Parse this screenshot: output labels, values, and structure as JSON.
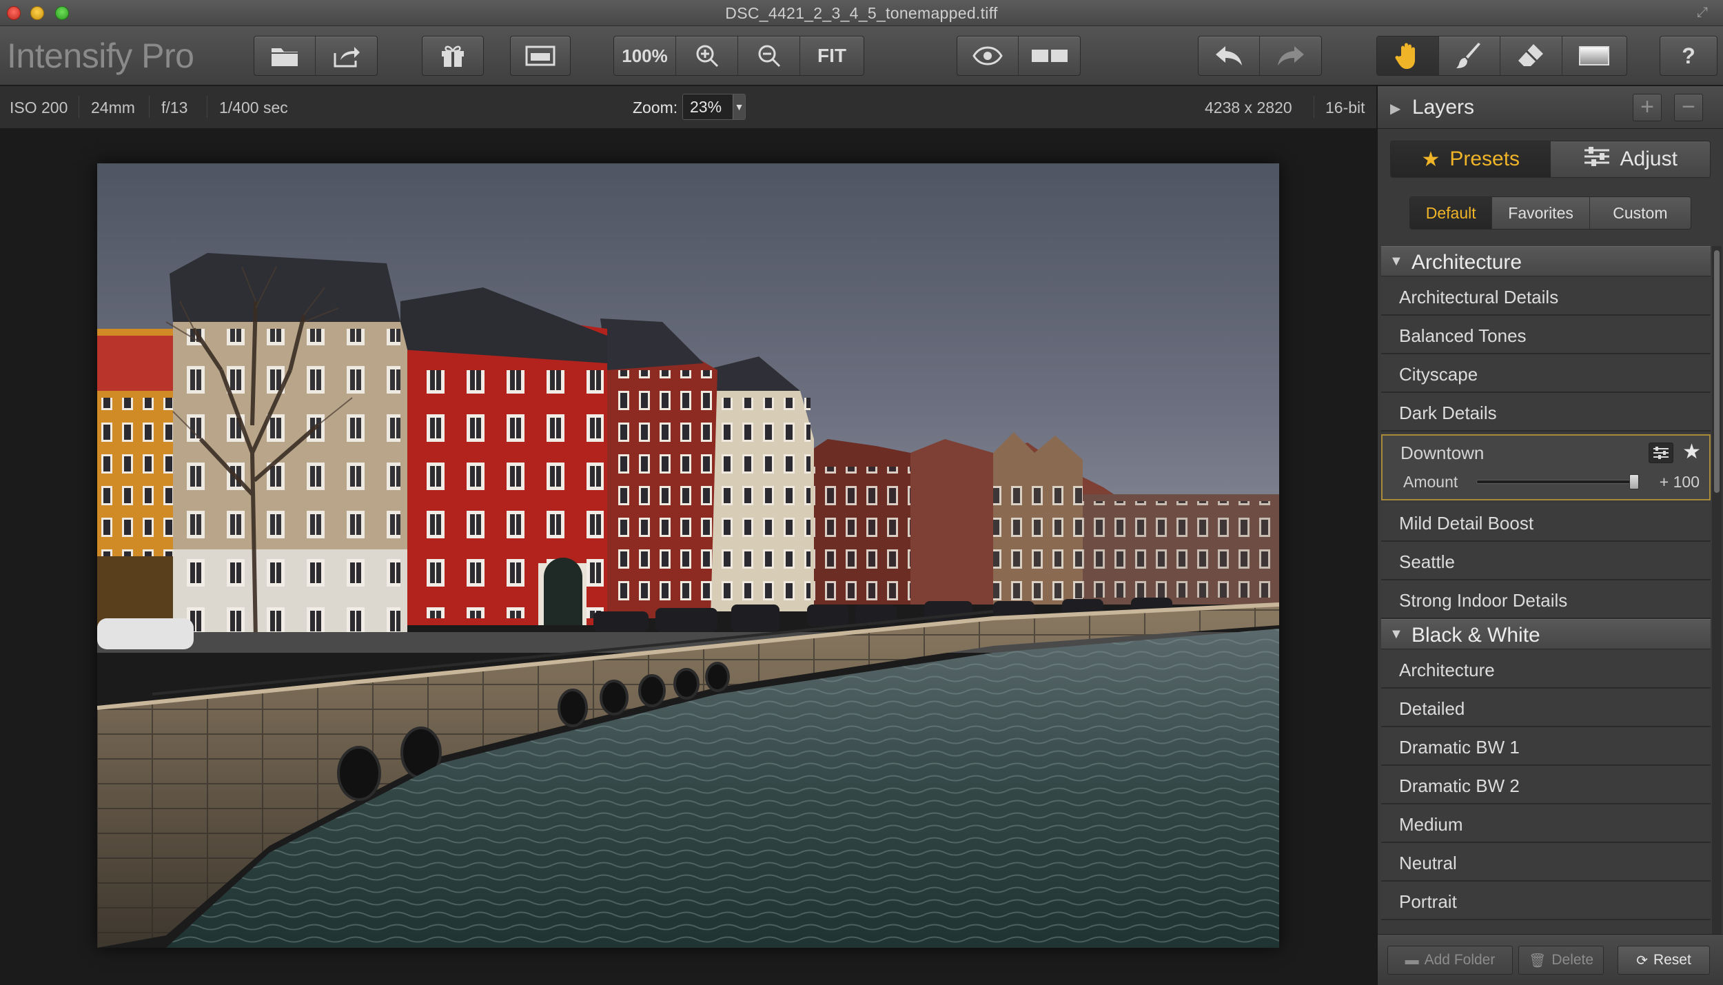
{
  "window": {
    "title": "DSC_4421_2_3_4_5_tonemapped.tiff"
  },
  "toolbar": {
    "app_name": "Intensify Pro",
    "zoom_100_label": "100%",
    "fit_label": "FIT",
    "accent_color": "#f0b428"
  },
  "info": {
    "iso": "ISO 200",
    "focal_length": "24mm",
    "aperture": "f/13",
    "shutter": "1/400 sec",
    "zoom_label": "Zoom:",
    "zoom_value": "23%",
    "dimensions": "4238 x 2820",
    "bit_depth": "16-bit"
  },
  "panel": {
    "layers_label": "Layers",
    "mode_tabs": {
      "presets": "Presets",
      "adjust": "Adjust"
    },
    "preset_tabs": {
      "default": "Default",
      "favorites": "Favorites",
      "custom": "Custom"
    },
    "categories": [
      {
        "name": "Architecture",
        "items": [
          "Architectural Details",
          "Balanced Tones",
          "Cityscape",
          "Dark Details",
          "Downtown",
          "Mild Detail Boost",
          "Seattle",
          "Strong Indoor Details"
        ]
      },
      {
        "name": "Black & White",
        "items": [
          "Architecture",
          "Detailed",
          "Dramatic BW 1",
          "Dramatic BW 2",
          "Medium",
          "Neutral",
          "Portrait"
        ]
      }
    ],
    "selected_preset": {
      "name": "Downtown",
      "amount_label": "Amount",
      "amount_value": "+ 100",
      "amount_fraction": 1.0
    },
    "bottom": {
      "add_folder": "Add Folder",
      "delete": "Delete",
      "reset": "Reset"
    }
  }
}
